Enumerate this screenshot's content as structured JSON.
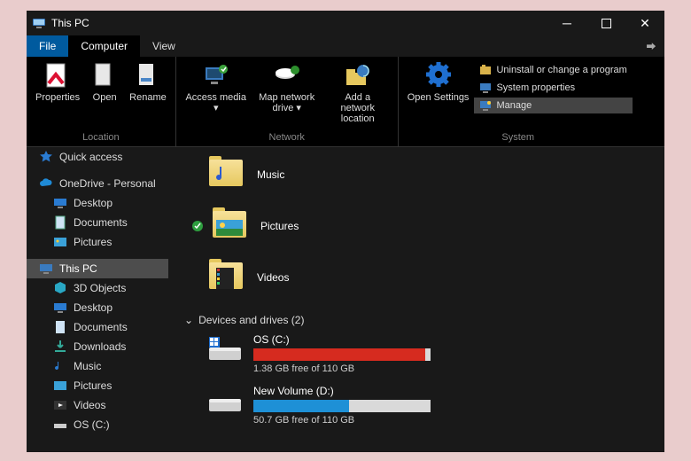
{
  "window": {
    "title": "This PC"
  },
  "menu": {
    "file": "File",
    "computer": "Computer",
    "view": "View"
  },
  "ribbon": {
    "location": {
      "group_label": "Location",
      "properties": "Properties",
      "open": "Open",
      "rename": "Rename"
    },
    "network": {
      "group_label": "Network",
      "access_media": "Access media",
      "map_drive": "Map network drive",
      "add_location": "Add a network location"
    },
    "system": {
      "group_label": "System",
      "open_settings": "Open Settings",
      "uninstall": "Uninstall or change a program",
      "properties": "System properties",
      "manage": "Manage"
    }
  },
  "sidebar": {
    "quick_access": "Quick access",
    "onedrive": "OneDrive - Personal",
    "od_desktop": "Desktop",
    "od_documents": "Documents",
    "od_pictures": "Pictures",
    "this_pc": "This PC",
    "pc_3d": "3D Objects",
    "pc_desktop": "Desktop",
    "pc_documents": "Documents",
    "pc_downloads": "Downloads",
    "pc_music": "Music",
    "pc_pictures": "Pictures",
    "pc_videos": "Videos",
    "pc_osc": "OS (C:)"
  },
  "content": {
    "music": "Music",
    "pictures": "Pictures",
    "videos": "Videos",
    "devices_header": "Devices and drives (2)",
    "drive_c": {
      "name": "OS (C:)",
      "free_text": "1.38 GB free of 110 GB",
      "fill_color": "#d62b1f",
      "fill_pct": 97
    },
    "drive_d": {
      "name": "New Volume (D:)",
      "free_text": "50.7 GB free of 110 GB",
      "fill_color": "#1e90d6",
      "fill_pct": 54
    }
  }
}
